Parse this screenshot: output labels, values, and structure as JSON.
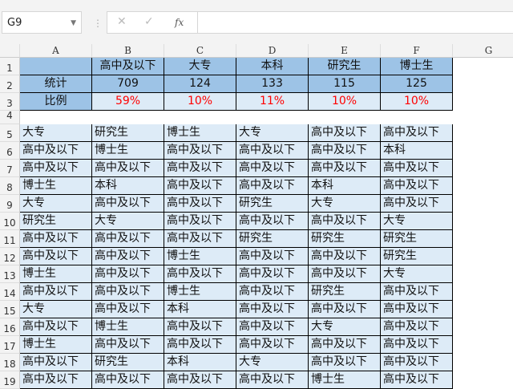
{
  "name_box": "G9",
  "formula_icons": [
    "cancel-icon",
    "confirm-icon",
    "function-icon"
  ],
  "fx_label": "fx",
  "columns": [
    "A",
    "B",
    "C",
    "D",
    "E",
    "F",
    "G"
  ],
  "rows": [
    "1",
    "2",
    "3",
    "4",
    "5",
    "6",
    "7",
    "8",
    "9",
    "10",
    "11",
    "12",
    "13",
    "14",
    "15",
    "16",
    "17",
    "18",
    "19"
  ],
  "summary": {
    "headers": [
      "",
      "高中及以下",
      "大专",
      "本科",
      "研究生",
      "博士生"
    ],
    "counts": [
      "统计",
      "709",
      "124",
      "133",
      "115",
      "125"
    ],
    "ratios": [
      "比例",
      "59%",
      "10%",
      "11%",
      "10%",
      "10%"
    ]
  },
  "data": [
    [
      "大专",
      "研究生",
      "博士生",
      "大专",
      "高中及以下",
      "高中及以下"
    ],
    [
      "高中及以下",
      "博士生",
      "高中及以下",
      "高中及以下",
      "高中及以下",
      "本科"
    ],
    [
      "高中及以下",
      "高中及以下",
      "高中及以下",
      "高中及以下",
      "高中及以下",
      "高中及以下"
    ],
    [
      "博士生",
      "本科",
      "高中及以下",
      "高中及以下",
      "本科",
      "高中及以下"
    ],
    [
      "大专",
      "高中及以下",
      "高中及以下",
      "研究生",
      "大专",
      "高中及以下"
    ],
    [
      "研究生",
      "大专",
      "高中及以下",
      "高中及以下",
      "高中及以下",
      "大专"
    ],
    [
      "高中及以下",
      "高中及以下",
      "高中及以下",
      "研究生",
      "研究生",
      "研究生"
    ],
    [
      "高中及以下",
      "高中及以下",
      "博士生",
      "高中及以下",
      "高中及以下",
      "研究生"
    ],
    [
      "博士生",
      "高中及以下",
      "高中及以下",
      "高中及以下",
      "高中及以下",
      "大专"
    ],
    [
      "高中及以下",
      "高中及以下",
      "博士生",
      "高中及以下",
      "研究生",
      "高中及以下"
    ],
    [
      "大专",
      "高中及以下",
      "本科",
      "高中及以下",
      "高中及以下",
      "高中及以下"
    ],
    [
      "高中及以下",
      "博士生",
      "高中及以下",
      "高中及以下",
      "大专",
      "高中及以下"
    ],
    [
      "博士生",
      "高中及以下",
      "高中及以下",
      "高中及以下",
      "高中及以下",
      "高中及以下"
    ],
    [
      "高中及以下",
      "研究生",
      "本科",
      "大专",
      "高中及以下",
      "高中及以下"
    ],
    [
      "高中及以下",
      "高中及以下",
      "高中及以下",
      "高中及以下",
      "博士生",
      "高中及以下"
    ]
  ],
  "colors": {
    "header_fill": "#9dc3e6",
    "data_fill": "#ddebf7",
    "percent_text": "#ff0000"
  }
}
